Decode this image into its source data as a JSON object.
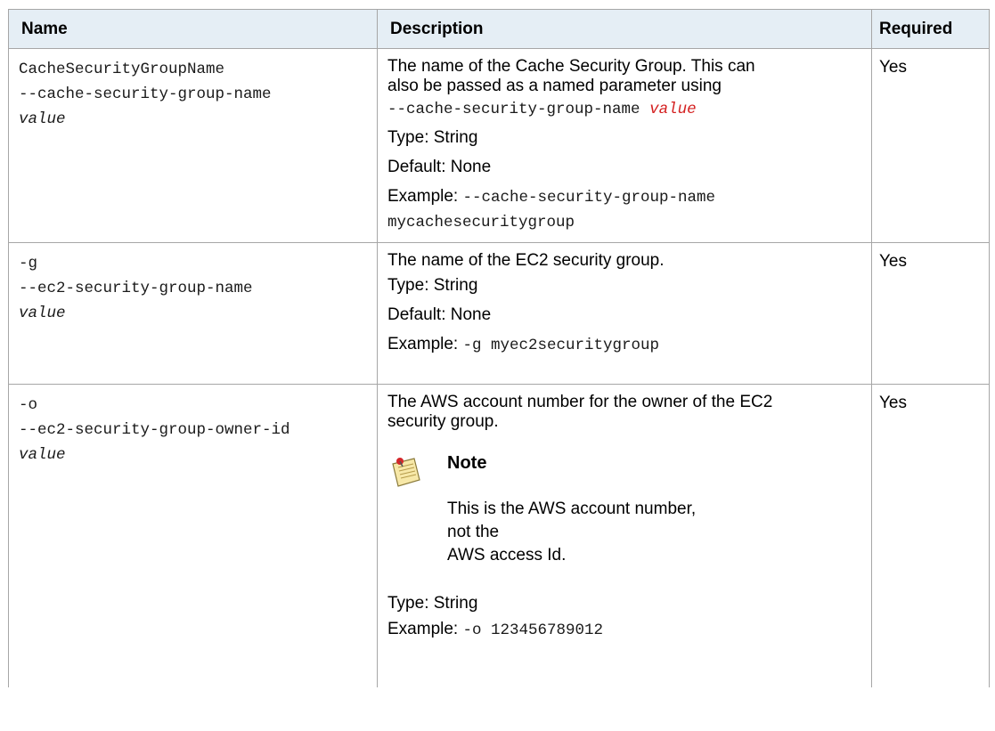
{
  "headers": {
    "name": "Name",
    "description": "Description",
    "required": "Required"
  },
  "rows": [
    {
      "name_lines": [
        "CacheSecurityGroupName",
        "--cache-security-group-name"
      ],
      "name_value": "value",
      "desc_text_1": "The name of the Cache Security Group. This can",
      "desc_text_2": "also be passed as a named parameter using",
      "desc_param_code": "--cache-security-group-name",
      "desc_param_value": "value",
      "type": "Type: String",
      "default": "Default: None",
      "example_label": "Example:",
      "example_code_1": "--cache-security-group-name",
      "example_code_2": "mycachesecuritygroup",
      "required": "Yes"
    },
    {
      "name_lines": [
        "-g",
        "--ec2-security-group-name"
      ],
      "name_value": "value",
      "desc_text": "The name of the EC2 security group.",
      "type": "Type: String",
      "default": "Default: None",
      "example_label": "Example:",
      "example_code": "-g myec2securitygroup",
      "required": "Yes"
    },
    {
      "name_lines": [
        "-o",
        "--ec2-security-group-owner-id"
      ],
      "name_value": "value",
      "desc_text_1": "The AWS account number for the owner of the EC2",
      "desc_text_2": "security group.",
      "note_icon": "note-icon",
      "note_title": "Note",
      "note_text_1": "This is the AWS account number, not the",
      "note_text_2": "AWS access Id.",
      "type": "Type: String",
      "example_label": "Example:",
      "example_code": "-o 123456789012",
      "required": "Yes"
    }
  ]
}
